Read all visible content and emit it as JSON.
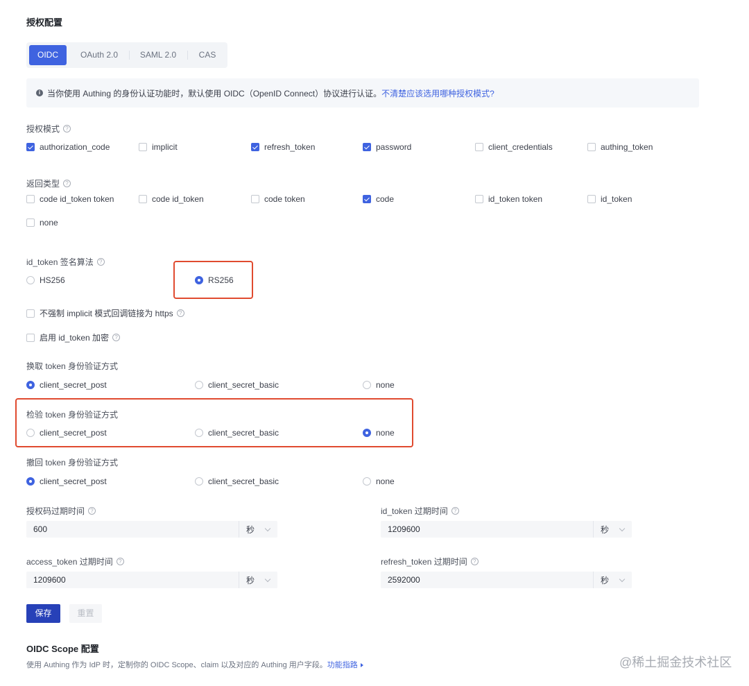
{
  "page": {
    "title": "授权配置"
  },
  "tabs": [
    {
      "label": "OIDC",
      "active": true
    },
    {
      "label": "OAuth 2.0",
      "active": false
    },
    {
      "label": "SAML 2.0",
      "active": false
    },
    {
      "label": "CAS",
      "active": false
    }
  ],
  "notice": {
    "text": "当你使用 Authing 的身份认证功能时，默认使用 OIDC（OpenID Connect）协议进行认证。",
    "link": "不清楚应该选用哪种授权模式?"
  },
  "grant_types": {
    "label": "授权模式",
    "options": [
      {
        "label": "authorization_code",
        "checked": true
      },
      {
        "label": "implicit",
        "checked": false
      },
      {
        "label": "refresh_token",
        "checked": true
      },
      {
        "label": "password",
        "checked": true
      },
      {
        "label": "client_credentials",
        "checked": false
      },
      {
        "label": "authing_token",
        "checked": false
      }
    ]
  },
  "response_types": {
    "label": "返回类型",
    "options": [
      {
        "label": "code id_token token",
        "checked": false
      },
      {
        "label": "code id_token",
        "checked": false
      },
      {
        "label": "code token",
        "checked": false
      },
      {
        "label": "code",
        "checked": true
      },
      {
        "label": "id_token token",
        "checked": false
      },
      {
        "label": "id_token",
        "checked": false
      },
      {
        "label": "none",
        "checked": false
      }
    ]
  },
  "id_token_alg": {
    "label": "id_token 签名算法",
    "options": [
      {
        "label": "HS256",
        "selected": false
      },
      {
        "label": "RS256",
        "selected": true
      }
    ]
  },
  "flags": {
    "implicit_https": "不强制 implicit 模式回调链接为 https",
    "id_token_encrypt": "启用 id_token 加密"
  },
  "token_endpoint_auth": {
    "label": "换取 token 身份验证方式",
    "options": [
      "client_secret_post",
      "client_secret_basic",
      "none"
    ],
    "selected": 0
  },
  "introspection_auth": {
    "label": "检验 token 身份验证方式",
    "options": [
      "client_secret_post",
      "client_secret_basic",
      "none"
    ],
    "selected": 2
  },
  "revocation_auth": {
    "label": "撤回 token 身份验证方式",
    "options": [
      "client_secret_post",
      "client_secret_basic",
      "none"
    ],
    "selected": 0
  },
  "expiry": {
    "code": {
      "label": "授权码过期时间",
      "value": "600",
      "unit": "秒"
    },
    "id_token": {
      "label": "id_token 过期时间",
      "value": "1209600",
      "unit": "秒"
    },
    "access_token": {
      "label": "access_token 过期时间",
      "value": "1209600",
      "unit": "秒"
    },
    "refresh_token": {
      "label": "refresh_token 过期时间",
      "value": "2592000",
      "unit": "秒"
    }
  },
  "buttons": {
    "save": "保存",
    "reset": "重置"
  },
  "scope": {
    "title": "OIDC Scope 配置",
    "desc": "使用 Authing 作为 IdP 时，定制你的 OIDC Scope、claim 以及对应的 Authing 用户字段。",
    "link": "功能指路"
  },
  "watermark": "@稀土掘金技术社区",
  "colors": {
    "accent": "#3f63e0",
    "highlight": "#e04a2f",
    "save": "#2741b8"
  }
}
